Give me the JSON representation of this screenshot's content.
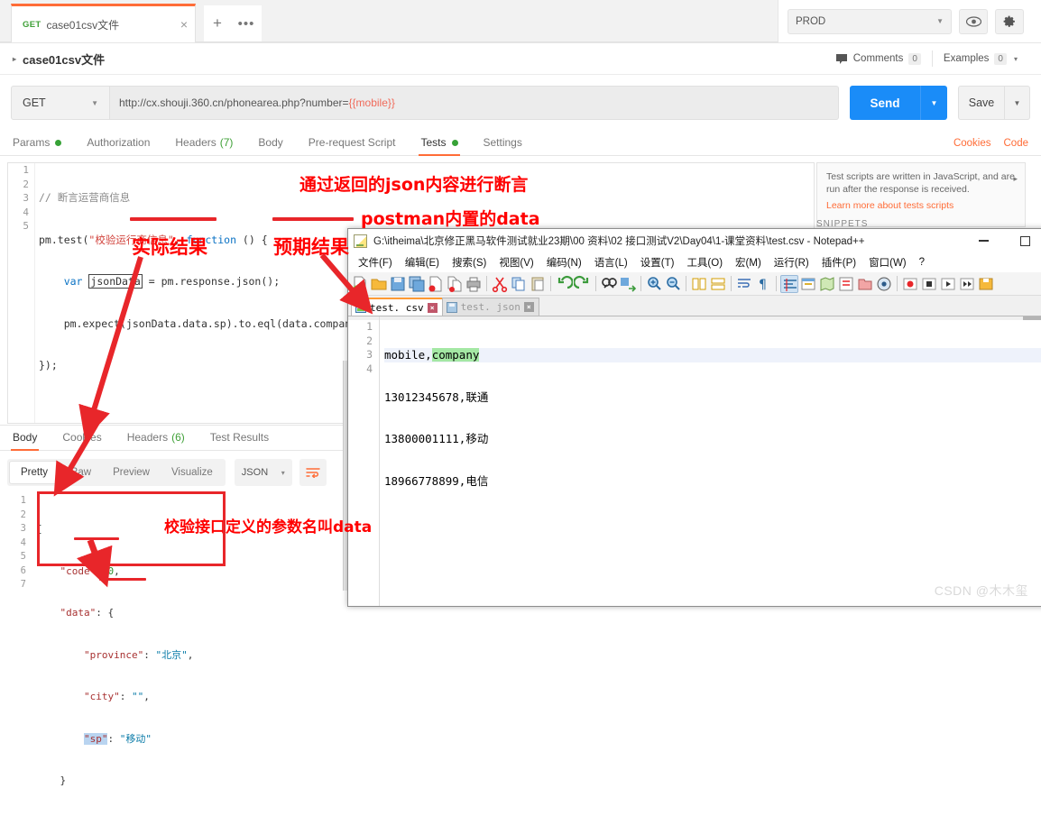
{
  "postman": {
    "tab": {
      "method": "GET",
      "name": "case01csv文件",
      "close": "×",
      "plus": "+",
      "more": "•••"
    },
    "environment": {
      "selected": "PROD",
      "eye_icon": "eye-icon",
      "gear_icon": "gear-icon"
    },
    "breadcrumb": {
      "arrow": "▸",
      "title": "case01csv文件"
    },
    "meta": {
      "comments_label": "Comments",
      "comments_count": "0",
      "examples_label": "Examples",
      "examples_count": "0",
      "caret": "▾"
    },
    "request": {
      "method": "GET",
      "url_base": "http://cx.shouji.360.cn/phonearea.php?number=",
      "url_var": "{{mobile}}",
      "send_label": "Send",
      "save_label": "Save",
      "caret": "▾"
    },
    "request_tabs": [
      {
        "label": "Params",
        "dot": true
      },
      {
        "label": "Authorization"
      },
      {
        "label": "Headers",
        "count": "(7)"
      },
      {
        "label": "Body"
      },
      {
        "label": "Pre-request Script"
      },
      {
        "label": "Tests",
        "dot": true,
        "active": true
      },
      {
        "label": "Settings"
      }
    ],
    "request_tabs_right": [
      "Cookies",
      "Code"
    ],
    "tests_code": {
      "line_numbers": [
        "1",
        "2",
        "3",
        "4",
        "5"
      ],
      "lines": [
        "// 断言运营商信息",
        "pm.test(\"校验运行商信息\", function () {",
        "    var jsonData = pm.response.json();",
        "    pm.expect(jsonData.data.sp).to.eql(data.company);",
        "});"
      ]
    },
    "helper": {
      "text": "Test scripts are written in JavaScript, and are run after the response is received.",
      "link": "Learn more about tests scripts",
      "snippets_label": "SNIPPETS",
      "arrow": "▸"
    },
    "response_tabs": [
      {
        "label": "Body",
        "active": true
      },
      {
        "label": "Cookies"
      },
      {
        "label": "Headers",
        "count": "(6)"
      },
      {
        "label": "Test Results"
      }
    ],
    "response_format": {
      "pills": [
        "Pretty",
        "Raw",
        "Preview",
        "Visualize"
      ],
      "active_pill": "Pretty",
      "type": "JSON",
      "caret": "▾",
      "wrap_icon": "word-wrap-icon"
    },
    "response_body": {
      "line_numbers": [
        "1",
        "2",
        "3",
        "4",
        "5",
        "6",
        "7"
      ],
      "lines": [
        "{",
        "    \"code\": 0,",
        "    \"data\": {",
        "        \"province\": \"北京\",",
        "        \"city\": \"\",",
        "        \"sp\": \"移动\"",
        "    }"
      ]
    }
  },
  "notepad": {
    "title": "G:\\itheima\\北京修正黑马软件测试就业23期\\00 资料\\02 接口测试V2\\Day04\\1-课堂资料\\test.csv - Notepad++",
    "window_controls": {
      "minimize": "minimize-icon",
      "maximize": "maximize-icon"
    },
    "menu": [
      "文件(F)",
      "编辑(E)",
      "搜索(S)",
      "视图(V)",
      "编码(N)",
      "语言(L)",
      "设置(T)",
      "工具(O)",
      "宏(M)",
      "运行(R)",
      "插件(P)",
      "窗口(W)",
      "?"
    ],
    "tabs": [
      {
        "label": "test. csv",
        "active": true,
        "close": "×"
      },
      {
        "label": "test. json",
        "active": false,
        "close": "×"
      }
    ],
    "csv": {
      "line_numbers": [
        "1",
        "2",
        "3",
        "4"
      ],
      "rows": [
        {
          "mobile": "mobile,",
          "company": "company",
          "selected": true
        },
        {
          "mobile": "13012345678,",
          "company": "联通"
        },
        {
          "mobile": "13800001111,",
          "company": "移动"
        },
        {
          "mobile": "18966778899,",
          "company": "电信"
        }
      ]
    }
  },
  "annotations": {
    "json_assert": "通过返回的json内容进行断言",
    "builtin_data": "postman内置的data",
    "actual_result": "实际结果",
    "expected_result": "预期结果",
    "param_name_data": "校验接口定义的参数名叫data"
  },
  "watermark": "CSDN @木木玺",
  "colors": {
    "accent": "#ff6c37",
    "send_blue": "#1a8cf8",
    "annotation_red": "#e8262a",
    "green_dot": "#37a237"
  }
}
